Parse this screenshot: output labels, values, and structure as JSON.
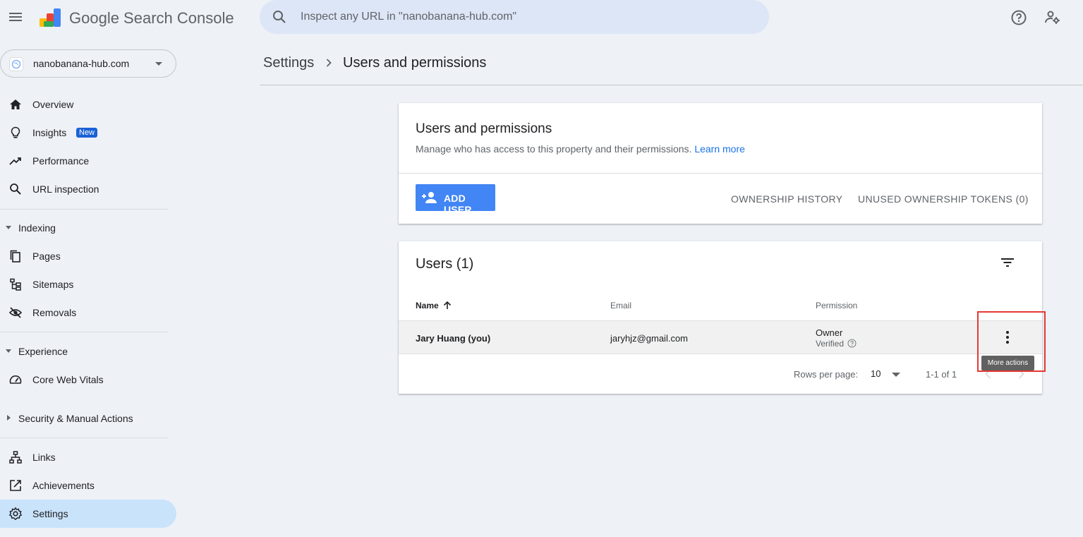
{
  "app": {
    "name": "Google Search Console"
  },
  "search": {
    "placeholder": "Inspect any URL in \"nanobanana-hub.com\""
  },
  "property": {
    "name": "nanobanana-hub.com"
  },
  "sidebar": {
    "items": [
      {
        "label": "Overview",
        "icon": "home-icon"
      },
      {
        "label": "Insights",
        "icon": "lightbulb-icon",
        "badge": "New"
      },
      {
        "label": "Performance",
        "icon": "trending-up-icon"
      },
      {
        "label": "URL inspection",
        "icon": "search-icon"
      }
    ],
    "indexing": {
      "label": "Indexing",
      "items": [
        {
          "label": "Pages",
          "icon": "pages-icon"
        },
        {
          "label": "Sitemaps",
          "icon": "sitemap-icon"
        },
        {
          "label": "Removals",
          "icon": "eye-off-icon"
        }
      ]
    },
    "experience": {
      "label": "Experience",
      "items": [
        {
          "label": "Core Web Vitals",
          "icon": "speedometer-icon"
        }
      ]
    },
    "security": {
      "label": "Security & Manual Actions"
    },
    "bottom": [
      {
        "label": "Links",
        "icon": "links-icon"
      },
      {
        "label": "Achievements",
        "icon": "achievements-icon"
      },
      {
        "label": "Settings",
        "icon": "gear-icon",
        "active": true
      }
    ]
  },
  "breadcrumb": {
    "root": "Settings",
    "current": "Users and permissions"
  },
  "permissions_card": {
    "title": "Users and permissions",
    "description": "Manage who has access to this property and their permissions.",
    "learn_more": "Learn more",
    "add_user": "ADD USER",
    "ownership_history": "OWNERSHIP HISTORY",
    "unused_tokens": "UNUSED OWNERSHIP TOKENS (0)"
  },
  "users_card": {
    "title": "Users (1)",
    "columns": {
      "name": "Name",
      "email": "Email",
      "permission": "Permission"
    },
    "rows": [
      {
        "name": "Jary Huang (you)",
        "email": "jaryhjz@gmail.com",
        "permission": "Owner",
        "status": "Verified"
      }
    ],
    "pagination": {
      "rows_label": "Rows per page:",
      "rows_value": "10",
      "range": "1-1 of 1"
    },
    "tooltip": "More actions"
  },
  "colors": {
    "accent": "#4285f4",
    "active_nav": "#c9e3fb",
    "highlight": "#e53935"
  }
}
